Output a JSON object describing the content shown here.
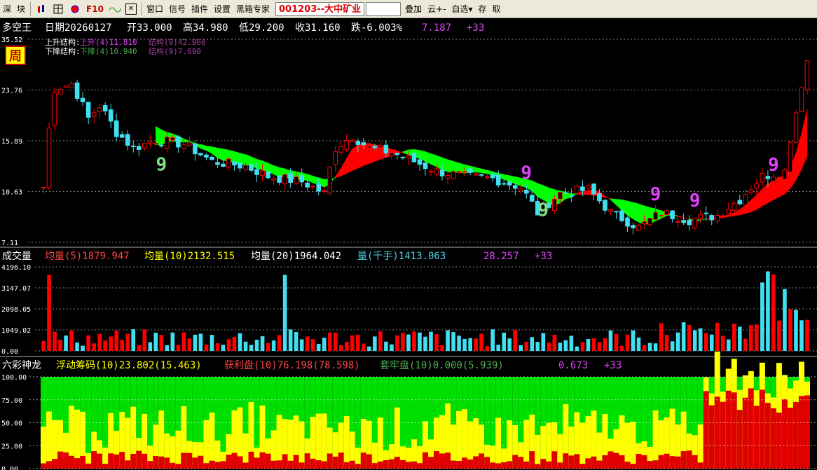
{
  "toolbar": {
    "b1": "深",
    "b2": "块",
    "b3": "F10",
    "b4": "窗口",
    "b5": "信号",
    "b6": "插件",
    "b7": "设置",
    "b8": "黑箱专家",
    "stock": "001203--大中矿业",
    "b9": "叠加",
    "b10": "云+-",
    "b11": "自选▾",
    "b12": "存",
    "b13": "取"
  },
  "main": {
    "name": "多空王",
    "date": "日期20260127",
    "open": "开33.000",
    "high": "高34.980",
    "low": "低29.200",
    "close": "收31.160",
    "chg": "跌-6.003%",
    "v1": "7.187",
    "v2": "+33",
    "period": "周",
    "up_l": "上升结构:",
    "up_v": "上升(4)11.810",
    "up_s": "结构(9)42.960",
    "dn_l": "下降结构:",
    "dn_v": "下降(4)10.940",
    "dn_s": "结构(9)7.690",
    "yticks": [
      "35.52",
      "23.76",
      "15.89",
      "10.63",
      "7.11"
    ]
  },
  "vol": {
    "name": "成交量",
    "ma5": "均量(5)1879.947",
    "ma10": "均量(10)2132.515",
    "ma20": "均量(20)1964.042",
    "vq": "量(千手)1413.063",
    "v1": "28.257",
    "v2": "+33",
    "yticks": [
      "4196.10",
      "3147.07",
      "2098.05",
      "1049.02",
      "0.00"
    ]
  },
  "chip": {
    "name": "六彩神龙",
    "f": "浮动筹码(10)23.802(15.463)",
    "p": "获利盘(10)76.198(78.598)",
    "t": "套牢盘(10)0.000(5.939)",
    "v1": "0.673",
    "v2": "+33",
    "yticks": [
      "100.00",
      "75.00",
      "50.00",
      "25.00",
      "0.00"
    ]
  },
  "chart_data": {
    "type": "candlestick",
    "periods": 137,
    "price_axis": {
      "min": 7.11,
      "max": 35.52,
      "scale": "log"
    },
    "close_path": [
      [
        0,
        11
      ],
      [
        2,
        24
      ],
      [
        5,
        25
      ],
      [
        8,
        19
      ],
      [
        10,
        21
      ],
      [
        13,
        17
      ],
      [
        16,
        15
      ],
      [
        20,
        16
      ],
      [
        25,
        15.5
      ],
      [
        30,
        13.5
      ],
      [
        36,
        13
      ],
      [
        40,
        12
      ],
      [
        46,
        11.5
      ],
      [
        50,
        10.5
      ],
      [
        52,
        15
      ],
      [
        55,
        16.5
      ],
      [
        58,
        15
      ],
      [
        62,
        14.5
      ],
      [
        66,
        13.5
      ],
      [
        70,
        12.5
      ],
      [
        75,
        12
      ],
      [
        80,
        11.8
      ],
      [
        85,
        11
      ],
      [
        88,
        9
      ],
      [
        92,
        10.5
      ],
      [
        97,
        10.8
      ],
      [
        101,
        9
      ],
      [
        106,
        8
      ],
      [
        110,
        9
      ],
      [
        115,
        8.5
      ],
      [
        120,
        8.8
      ],
      [
        124,
        10
      ],
      [
        128,
        12
      ],
      [
        132,
        12.5
      ],
      [
        134,
        20
      ],
      [
        136,
        30
      ],
      [
        137,
        31.16
      ]
    ],
    "count_labels": [
      "9",
      "9",
      "9",
      "9",
      "9",
      "9"
    ],
    "vol_axis": {
      "min": 0,
      "max": 4196.1
    },
    "chip_axis": {
      "min": 0,
      "max": 100
    }
  }
}
